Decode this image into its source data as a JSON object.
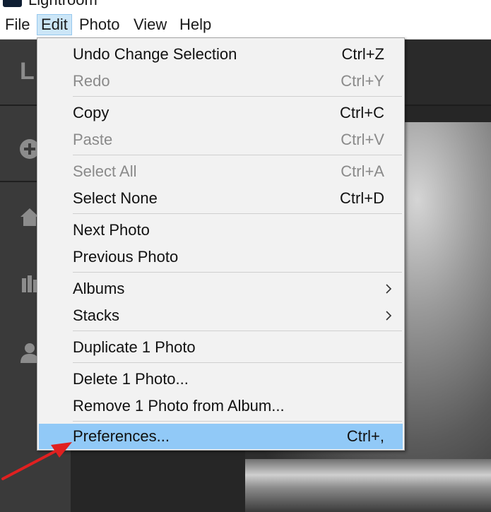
{
  "window": {
    "title": "Lightroom"
  },
  "menubar": {
    "items": [
      {
        "label": "File"
      },
      {
        "label": "Edit"
      },
      {
        "label": "Photo"
      },
      {
        "label": "View"
      },
      {
        "label": "Help"
      }
    ],
    "active": "Edit"
  },
  "sidebar": {
    "logo": "L"
  },
  "edit_menu": {
    "items": [
      {
        "label": "Undo Change Selection",
        "shortcut": "Ctrl+Z",
        "enabled": true
      },
      {
        "label": "Redo",
        "shortcut": "Ctrl+Y",
        "enabled": false
      },
      {
        "label": "Copy",
        "shortcut": "Ctrl+C",
        "enabled": true
      },
      {
        "label": "Paste",
        "shortcut": "Ctrl+V",
        "enabled": false
      },
      {
        "label": "Select All",
        "shortcut": "Ctrl+A",
        "enabled": false
      },
      {
        "label": "Select None",
        "shortcut": "Ctrl+D",
        "enabled": true
      },
      {
        "label": "Next Photo",
        "shortcut": "",
        "enabled": true
      },
      {
        "label": "Previous Photo",
        "shortcut": "",
        "enabled": true
      },
      {
        "label": "Albums",
        "shortcut": "",
        "enabled": true,
        "submenu": true
      },
      {
        "label": "Stacks",
        "shortcut": "",
        "enabled": true,
        "submenu": true
      },
      {
        "label": "Duplicate 1 Photo",
        "shortcut": "",
        "enabled": true
      },
      {
        "label": "Delete 1 Photo...",
        "shortcut": "",
        "enabled": true
      },
      {
        "label": "Remove 1 Photo from Album...",
        "shortcut": "",
        "enabled": true
      },
      {
        "label": "Preferences...",
        "shortcut": "Ctrl+,",
        "enabled": true,
        "highlighted": true
      }
    ]
  },
  "colors": {
    "highlight": "#91c9f7",
    "menu_background": "#f2f2f2",
    "disabled_text": "#8a8a8a",
    "annotation_arrow": "#e02020"
  },
  "icons": {
    "submenu_arrow": "chevron-right-icon",
    "rail": [
      "add-icon",
      "home-icon",
      "library-icon",
      "people-icon"
    ]
  }
}
